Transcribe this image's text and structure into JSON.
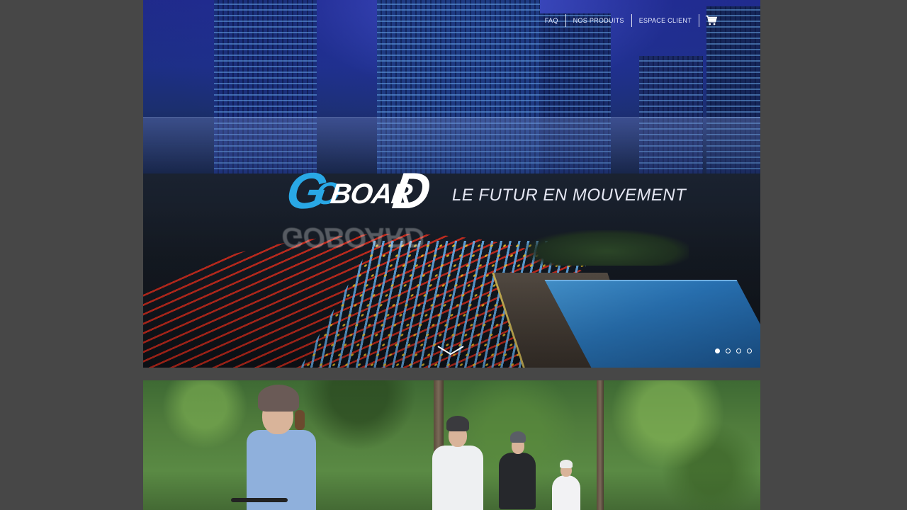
{
  "nav": {
    "items": [
      {
        "label": "FAQ"
      },
      {
        "label": "NOS PRODUITS"
      },
      {
        "label": "ESPACE CLIENT"
      }
    ],
    "cart_icon": "shopping-cart-icon"
  },
  "hero": {
    "logo": {
      "big_g": "G",
      "small_o": "O",
      "middle": "BOAR",
      "big_d": "D",
      "reflection": "GOBOARD",
      "colors": {
        "accent": "#29a8e6",
        "primary": "#ffffff"
      }
    },
    "tagline": "LE FUTUR EN MOUVEMENT",
    "scroll_icon": "chevron-down-icon",
    "slides": {
      "count": 4,
      "active": 1
    }
  },
  "colors": {
    "page_background": "#474747",
    "accent": "#29a8e6"
  }
}
